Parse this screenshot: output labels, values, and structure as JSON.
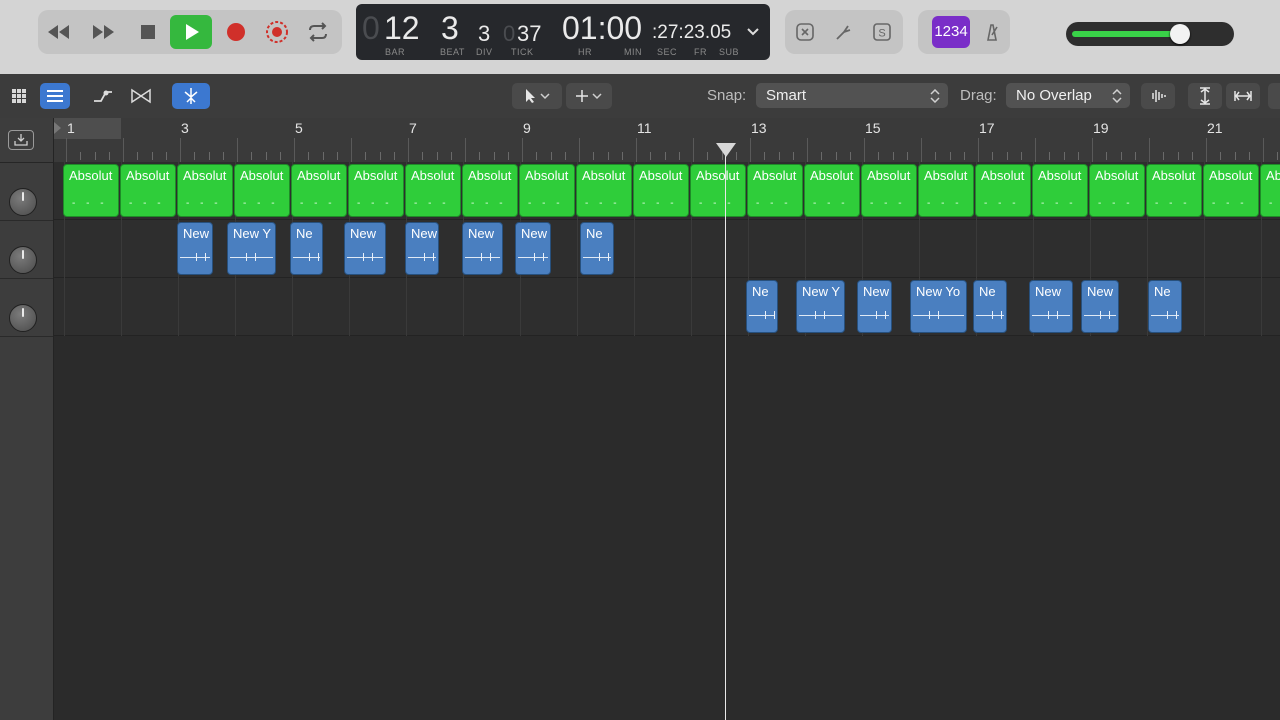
{
  "transport": {
    "lcd": {
      "bar_ghost": "0",
      "bar": "12",
      "beat": "3",
      "div": "3",
      "tick_ghost": "0",
      "tick": "37",
      "hr_min": "01:00",
      "sec_fr_sub": ":27:23.05",
      "labels": {
        "bar": "BAR",
        "beat": "BEAT",
        "div": "DIV",
        "tick": "TICK",
        "hr": "HR",
        "min": "MIN",
        "sec": "SEC",
        "fr": "FR",
        "sub": "SUB"
      }
    },
    "count_in": "1234",
    "master_volume_fraction": 0.78,
    "colors": {
      "play": "#35b83e",
      "record": "#d0302a",
      "count_in_bg": "#7a2ec8",
      "meter": "#39d248"
    }
  },
  "toolbar": {
    "snap_label": "Snap:",
    "snap_value": "Smart",
    "drag_label": "Drag:",
    "drag_value": "No Overlap"
  },
  "ruler": {
    "bars": [
      "1",
      "3",
      "5",
      "7",
      "9",
      "11",
      "13",
      "15",
      "17",
      "19",
      "21"
    ]
  },
  "tracks": [
    {
      "name": "track-1",
      "color": "#2fcd3a",
      "regions": [
        "Absolut",
        "Absolut",
        "Absolut",
        "Absolut",
        "Absolut",
        "Absolut",
        "Absolut",
        "Absolut",
        "Absolut",
        "Absolut",
        "Absolut",
        "Absolut",
        "Absolut",
        "Absolut",
        "Absolut",
        "Absolut",
        "Absolut",
        "Absolut",
        "Absolut",
        "Absolut",
        "Absolut",
        "Absolut"
      ]
    },
    {
      "name": "track-2",
      "color": "#4a7fc0",
      "regions": [
        "New",
        "New Y",
        "Ne",
        "New",
        "New",
        "New",
        "New",
        "Ne"
      ]
    },
    {
      "name": "track-3",
      "color": "#4a7fc0",
      "regions": [
        "Ne",
        "New Y",
        "New",
        "New Yo",
        "Ne",
        "New",
        "New",
        "Ne"
      ]
    }
  ]
}
